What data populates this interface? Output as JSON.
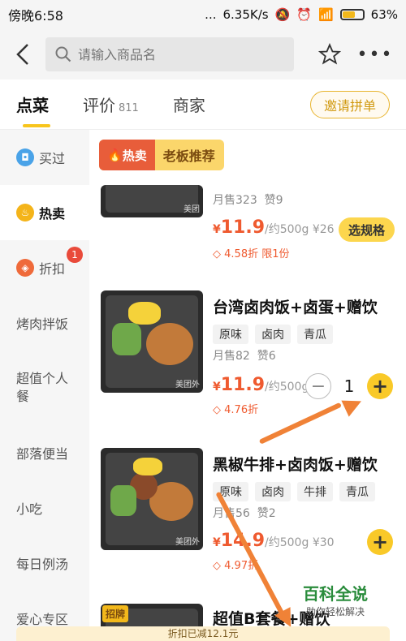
{
  "status": {
    "time": "傍晚6:58",
    "dots": "...",
    "speed": "6.35K/s",
    "battery": "63%",
    "battery_level": 0.63
  },
  "header": {
    "search_placeholder": "请输入商品名"
  },
  "tabs": [
    {
      "label": "点菜",
      "count": ""
    },
    {
      "label": "评价",
      "count": "811"
    },
    {
      "label": "商家",
      "count": ""
    }
  ],
  "invite_label": "邀请拼单",
  "sidebar": [
    {
      "label": "买过",
      "icon": "bag-icon"
    },
    {
      "label": "热卖",
      "icon": "flame-icon"
    },
    {
      "label": "折扣",
      "icon": "discount-icon",
      "badge": "1"
    },
    {
      "label": "烤肉拌饭"
    },
    {
      "label": "超值个人餐"
    },
    {
      "label": "部落便当"
    },
    {
      "label": "小吃"
    },
    {
      "label": "每日例汤"
    },
    {
      "label": "爱心专区"
    }
  ],
  "section": {
    "hot": "热卖",
    "title": "老板推荐"
  },
  "items": [
    {
      "sales": "月售323",
      "likes": "赞9",
      "currency": "¥",
      "price": "11.9",
      "weight": "/约500g",
      "orig": "¥26",
      "discount": "4.58折",
      "limit": "限1份",
      "spec_label": "选规格",
      "watermark": "美团"
    },
    {
      "name": "台湾卤肉饭+卤蛋+赠饮",
      "tags": [
        "原味",
        "卤肉",
        "青瓜"
      ],
      "sales": "月售82",
      "likes": "赞6",
      "currency": "¥",
      "price": "11.9",
      "weight": "/约500g",
      "discount": "4.76折",
      "quantity": "1",
      "watermark": "美团外"
    },
    {
      "name": "黑椒牛排+卤肉饭+赠饮",
      "tags": [
        "原味",
        "卤肉",
        "牛排",
        "青瓜"
      ],
      "sales": "月售56",
      "likes": "赞2",
      "currency": "¥",
      "price": "14.9",
      "weight": "/约500g",
      "orig": "¥30",
      "discount": "4.97折",
      "watermark": "美团外"
    },
    {
      "name": "超值B套餐+赠饮",
      "sign": "招牌"
    }
  ],
  "bottom_text": "折扣已减12.1元",
  "watermark": {
    "title": "百科全说",
    "subtitle": "助你轻松解决"
  },
  "colors": {
    "accent": "#f9c928",
    "price": "#ef5a2f",
    "arrow": "#f08237"
  }
}
